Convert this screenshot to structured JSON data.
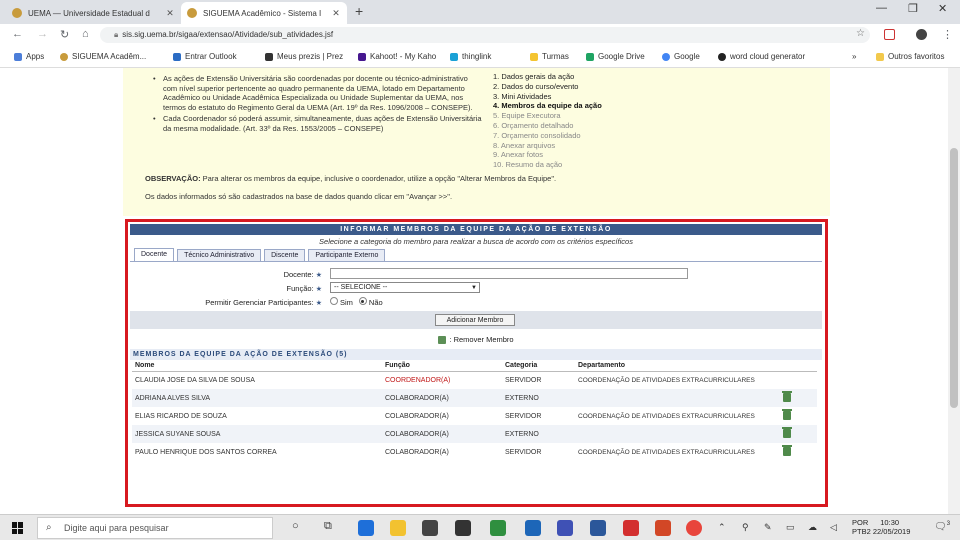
{
  "browser": {
    "tabs": [
      {
        "title": "UEMA — Universidade Estadual d",
        "active": false
      },
      {
        "title": "SIGUEMA Acadêmico - Sistema I",
        "active": true
      }
    ],
    "url": "sis.sig.uema.br/sigaa/extensao/Atividade/sub_atividades.jsf",
    "bookmarks": [
      "Apps",
      "SIGUEMA Acadêm...",
      "Entrar Outlook",
      "Meus prezis | Prez",
      "Kahoot! - My Kaho",
      "thinglink",
      "Turmas",
      "Google Drive",
      "Google",
      "word cloud generator",
      "Outros favoritos"
    ]
  },
  "notes": {
    "bullet1": "As ações de Extensão Universitária são coordenadas por docente ou técnico-administrativo com nível superior pertencente ao quadro permanente da UEMA, lotado em Departamento Acadêmico ou Unidade Acadêmica Especializada ou Unidade Suplementar da UEMA, nos termos do estatuto do Regimento Geral da UEMA (Art. 19º da Res. 1096/2008 – CONSEPE).",
    "bullet2": "Cada Coordenador só poderá assumir, simultaneamente, duas ações de Extensão Universitária da mesma modalidade. (Art. 33º da Res. 1553/2005 – CONSEPE)",
    "obs_label": "OBSERVAÇÃO:",
    "obs_text": "Para alterar os membros da equipe, inclusive o coordenador, utilize a opção \"Alterar Membros da Equipe\".",
    "info": "Os dados informados só são cadastrados na base de dados quando clicar em \"Avançar >>\"."
  },
  "steps": [
    {
      "label": "1. Dados gerais da ação",
      "state": "done"
    },
    {
      "label": "2. Dados do curso/evento",
      "state": "done"
    },
    {
      "label": "3. Mini Atividades",
      "state": "done"
    },
    {
      "label": "4. Membros da equipe da ação",
      "state": "current"
    },
    {
      "label": "5. Equipe Executora",
      "state": "todo"
    },
    {
      "label": "6. Orçamento detalhado",
      "state": "todo"
    },
    {
      "label": "7. Orçamento consolidado",
      "state": "todo"
    },
    {
      "label": "8. Anexar arquivos",
      "state": "todo"
    },
    {
      "label": "9. Anexar fotos",
      "state": "todo"
    },
    {
      "label": "10. Resumo da ação",
      "state": "todo"
    }
  ],
  "form": {
    "header": "INFORMAR MEMBROS DA EQUIPE DA AÇÃO DE EXTENSÃO",
    "subtitle": "Selecione a categoria do membro para realizar a busca de acordo com os critérios específicos",
    "tabs": [
      "Docente",
      "Técnico Administrativo",
      "Discente",
      "Participante Externo"
    ],
    "docente_label": "Docente:",
    "docente_value": "",
    "funcao_label": "Função:",
    "funcao_value": "-- SELECIONE --",
    "gerenciar_label": "Permitir Gerenciar Participantes:",
    "radio_yes": "Sim",
    "radio_no": "Não",
    "add_button": "Adicionar Membro",
    "remove_legend": ": Remover Membro"
  },
  "members": {
    "title": "MEMBROS DA EQUIPE DA AÇÃO DE EXTENSÃO (5)",
    "columns": [
      "Nome",
      "Função",
      "Categoria",
      "Departamento"
    ],
    "rows": [
      {
        "nome": "CLAUDIA JOSE DA SILVA DE SOUSA",
        "funcao": "COORDENADOR(A)",
        "categoria": "SERVIDOR",
        "departamento": "COORDENAÇÃO DE ATIVIDADES EXTRACURRICULARES",
        "removable": false
      },
      {
        "nome": "ADRIANA ALVES SILVA",
        "funcao": "COLABORADOR(A)",
        "categoria": "EXTERNO",
        "departamento": "",
        "removable": true
      },
      {
        "nome": "ELIAS RICARDO DE SOUZA",
        "funcao": "COLABORADOR(A)",
        "categoria": "SERVIDOR",
        "departamento": "COORDENAÇÃO DE ATIVIDADES EXTRACURRICULARES",
        "removable": true
      },
      {
        "nome": "JESSICA SUYANE SOUSA",
        "funcao": "COLABORADOR(A)",
        "categoria": "EXTERNO",
        "departamento": "",
        "removable": true
      },
      {
        "nome": "PAULO HENRIQUE DOS SANTOS CORREA",
        "funcao": "COLABORADOR(A)",
        "categoria": "SERVIDOR",
        "departamento": "COORDENAÇÃO DE ATIVIDADES EXTRACURRICULARES",
        "removable": true
      }
    ]
  },
  "taskbar": {
    "search_placeholder": "Digite aqui para pesquisar",
    "lang": "POR",
    "lang2": "PTB2",
    "time": "10:30",
    "date": "22/05/2019",
    "notification_count": "3"
  },
  "colors": {
    "accent": "#3b5a8a",
    "highlight_frame": "#d71920",
    "page_bg": "#fdfde0"
  }
}
